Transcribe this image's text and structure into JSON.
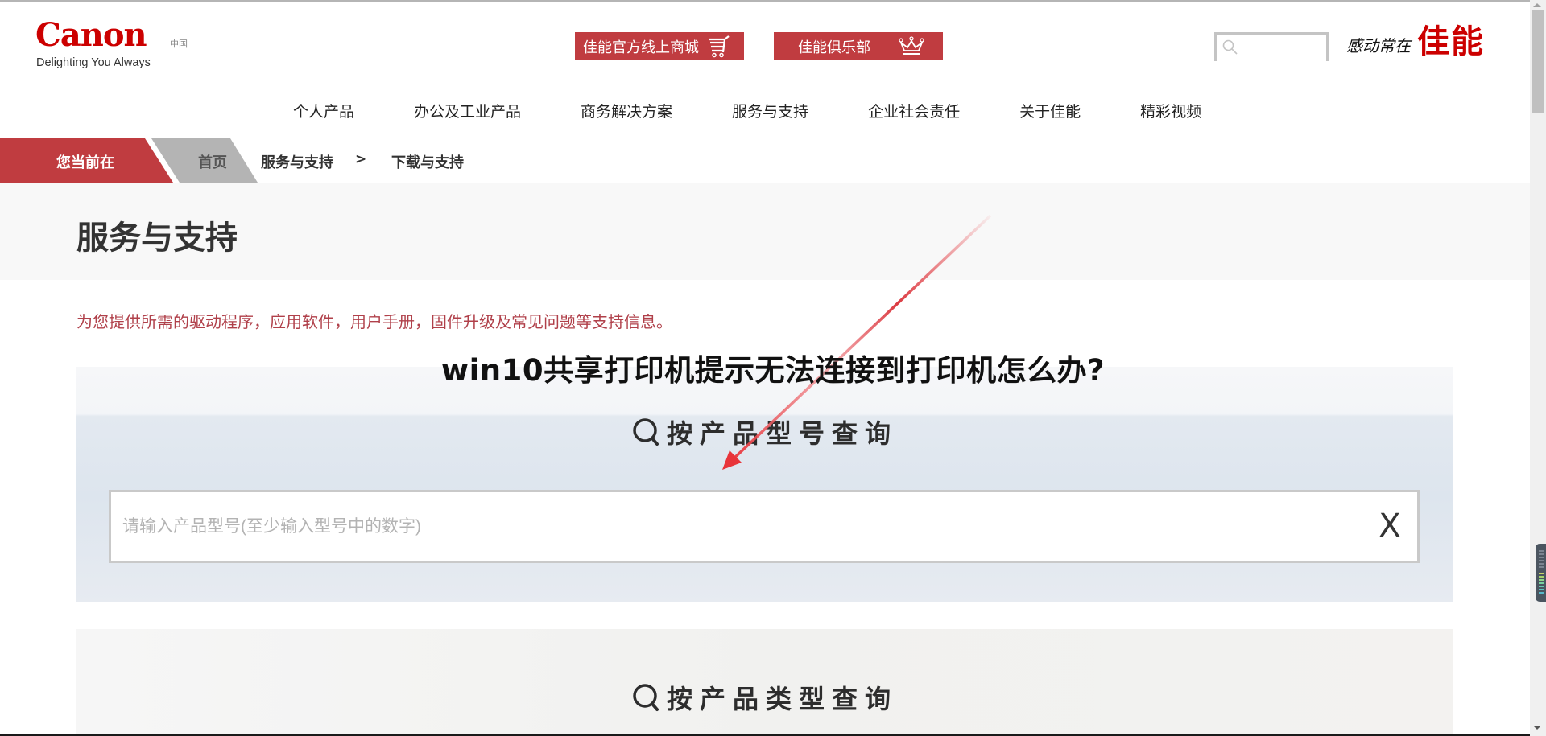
{
  "header": {
    "logo_text": "Canon",
    "region_label": "中国",
    "tagline": "Delighting You Always",
    "promo_buttons": [
      {
        "label": "佳能官方线上商城",
        "icon": "shopping-cart-icon"
      },
      {
        "label": "佳能俱乐部",
        "icon": "crown-icon"
      }
    ],
    "search": {
      "placeholder": "",
      "value": "",
      "icon": "search-icon"
    },
    "slogan_small": "感动常在",
    "slogan_big": "佳能"
  },
  "nav": {
    "items": [
      "个人产品",
      "办公及工业产品",
      "商务解决方案",
      "服务与支持",
      "企业社会责任",
      "关于佳能",
      "精彩视频"
    ]
  },
  "breadcrumb": {
    "here_label": "您当前在",
    "items": [
      "首页",
      "服务与支持",
      "下载与支持"
    ],
    "separator": ">"
  },
  "page": {
    "title": "服务与支持",
    "intro": "为您提供所需的驱动程序，应用软件，用户手册，固件升级及常见问题等支持信息。"
  },
  "overlay": {
    "headline": "win10共享打印机提示无法连接到打印机怎么办?",
    "arrow_color": "#e8343a"
  },
  "model_search": {
    "heading": "按产品型号查询",
    "placeholder": "请输入产品型号(至少输入型号中的数字)",
    "value": "",
    "clear_label": "X"
  },
  "category_search": {
    "heading": "按产品类型查询"
  },
  "colors": {
    "brand_red": "#cc0000",
    "button_red": "#c03c40",
    "breadcrumb_gray": "#b4b4b4",
    "intro_text": "#b0404a"
  }
}
